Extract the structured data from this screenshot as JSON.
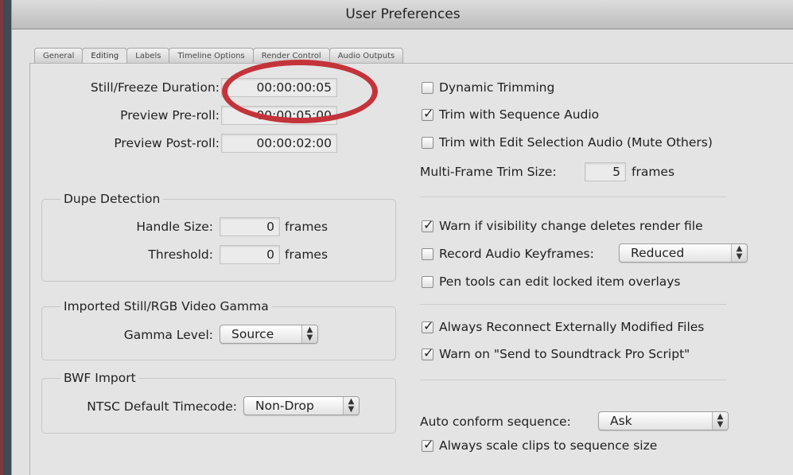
{
  "window": {
    "title": "User Preferences"
  },
  "tabs": [
    "General",
    "Editing",
    "Labels",
    "Timeline Options",
    "Render Control",
    "Audio Outputs"
  ],
  "left": {
    "still_freeze": {
      "label": "Still/Freeze Duration:",
      "value": "00:00:00:05"
    },
    "preroll": {
      "label": "Preview Pre-roll:",
      "value": "00:00:05:00"
    },
    "postroll": {
      "label": "Preview Post-roll:",
      "value": "00:00:02:00"
    },
    "dupe": {
      "title": "Dupe Detection",
      "handle_label": "Handle Size:",
      "handle_value": "0",
      "handle_unit": "frames",
      "threshold_label": "Threshold:",
      "threshold_value": "0",
      "threshold_unit": "frames"
    },
    "gamma": {
      "title": "Imported Still/RGB Video Gamma",
      "label": "Gamma Level:",
      "value": "Source"
    },
    "bwf": {
      "title": "BWF Import",
      "label": "NTSC Default Timecode:",
      "value": "Non-Drop"
    }
  },
  "right": {
    "dynamic_trimming": {
      "label": "Dynamic Trimming",
      "checked": false
    },
    "trim_seq_audio": {
      "label": "Trim with Sequence Audio",
      "checked": true
    },
    "trim_edit_sel": {
      "label": "Trim with Edit Selection Audio (Mute Others)",
      "checked": false
    },
    "multi_frame": {
      "label": "Multi-Frame Trim Size:",
      "value": "5",
      "unit": "frames"
    },
    "warn_visibility": {
      "label": "Warn if visibility change deletes render file",
      "checked": true
    },
    "record_audio": {
      "label": "Record Audio Keyframes:",
      "checked": false,
      "value": "Reduced"
    },
    "pen_tools": {
      "label": "Pen tools can edit locked item overlays",
      "checked": false
    },
    "always_reconnect": {
      "label": "Always Reconnect Externally Modified Files",
      "checked": true
    },
    "warn_soundtrack": {
      "label": "Warn on \"Send to Soundtrack Pro Script\"",
      "checked": true
    },
    "auto_conform": {
      "label": "Auto conform sequence:",
      "value": "Ask"
    },
    "always_scale": {
      "label": "Always scale clips to sequence size",
      "checked": true
    }
  },
  "colors": {
    "highlight": "#c4333a",
    "window_bg": "#e2e2e2"
  },
  "icons": {
    "check": "checkmark-icon",
    "popup": "popup-arrows-icon"
  }
}
